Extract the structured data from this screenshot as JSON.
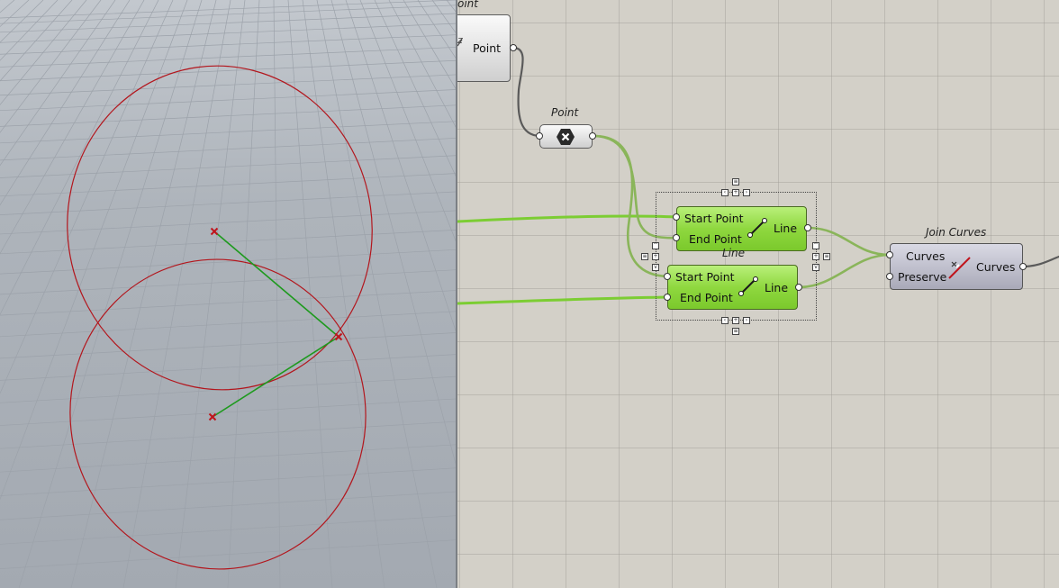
{
  "viewport": {
    "name": "rhino-perspective-viewport"
  },
  "canvas": {
    "components": {
      "point_top": {
        "output_label": "Point",
        "nick_partial": "oint",
        "icon": "point-param-icon"
      },
      "point_construct": {
        "nickname": "Point",
        "icon": "construct-point-icon"
      },
      "line1": {
        "in1": "Start Point",
        "in2": "End Point",
        "out": "Line",
        "icon": "line-icon"
      },
      "line2": {
        "nickname": "Line",
        "in1": "Start Point",
        "in2": "End Point",
        "out": "Line",
        "icon": "line-icon"
      },
      "join": {
        "nickname": "Join Curves",
        "in1": "Curves",
        "in2": "Preserve",
        "out": "Curves",
        "icon": "join-curves-icon"
      }
    },
    "colors": {
      "wire_green": "#7ccd33",
      "wire_dark": "#5a5a5a",
      "circle_red": "#b3161d",
      "line_green": "#1e9a1e"
    }
  }
}
